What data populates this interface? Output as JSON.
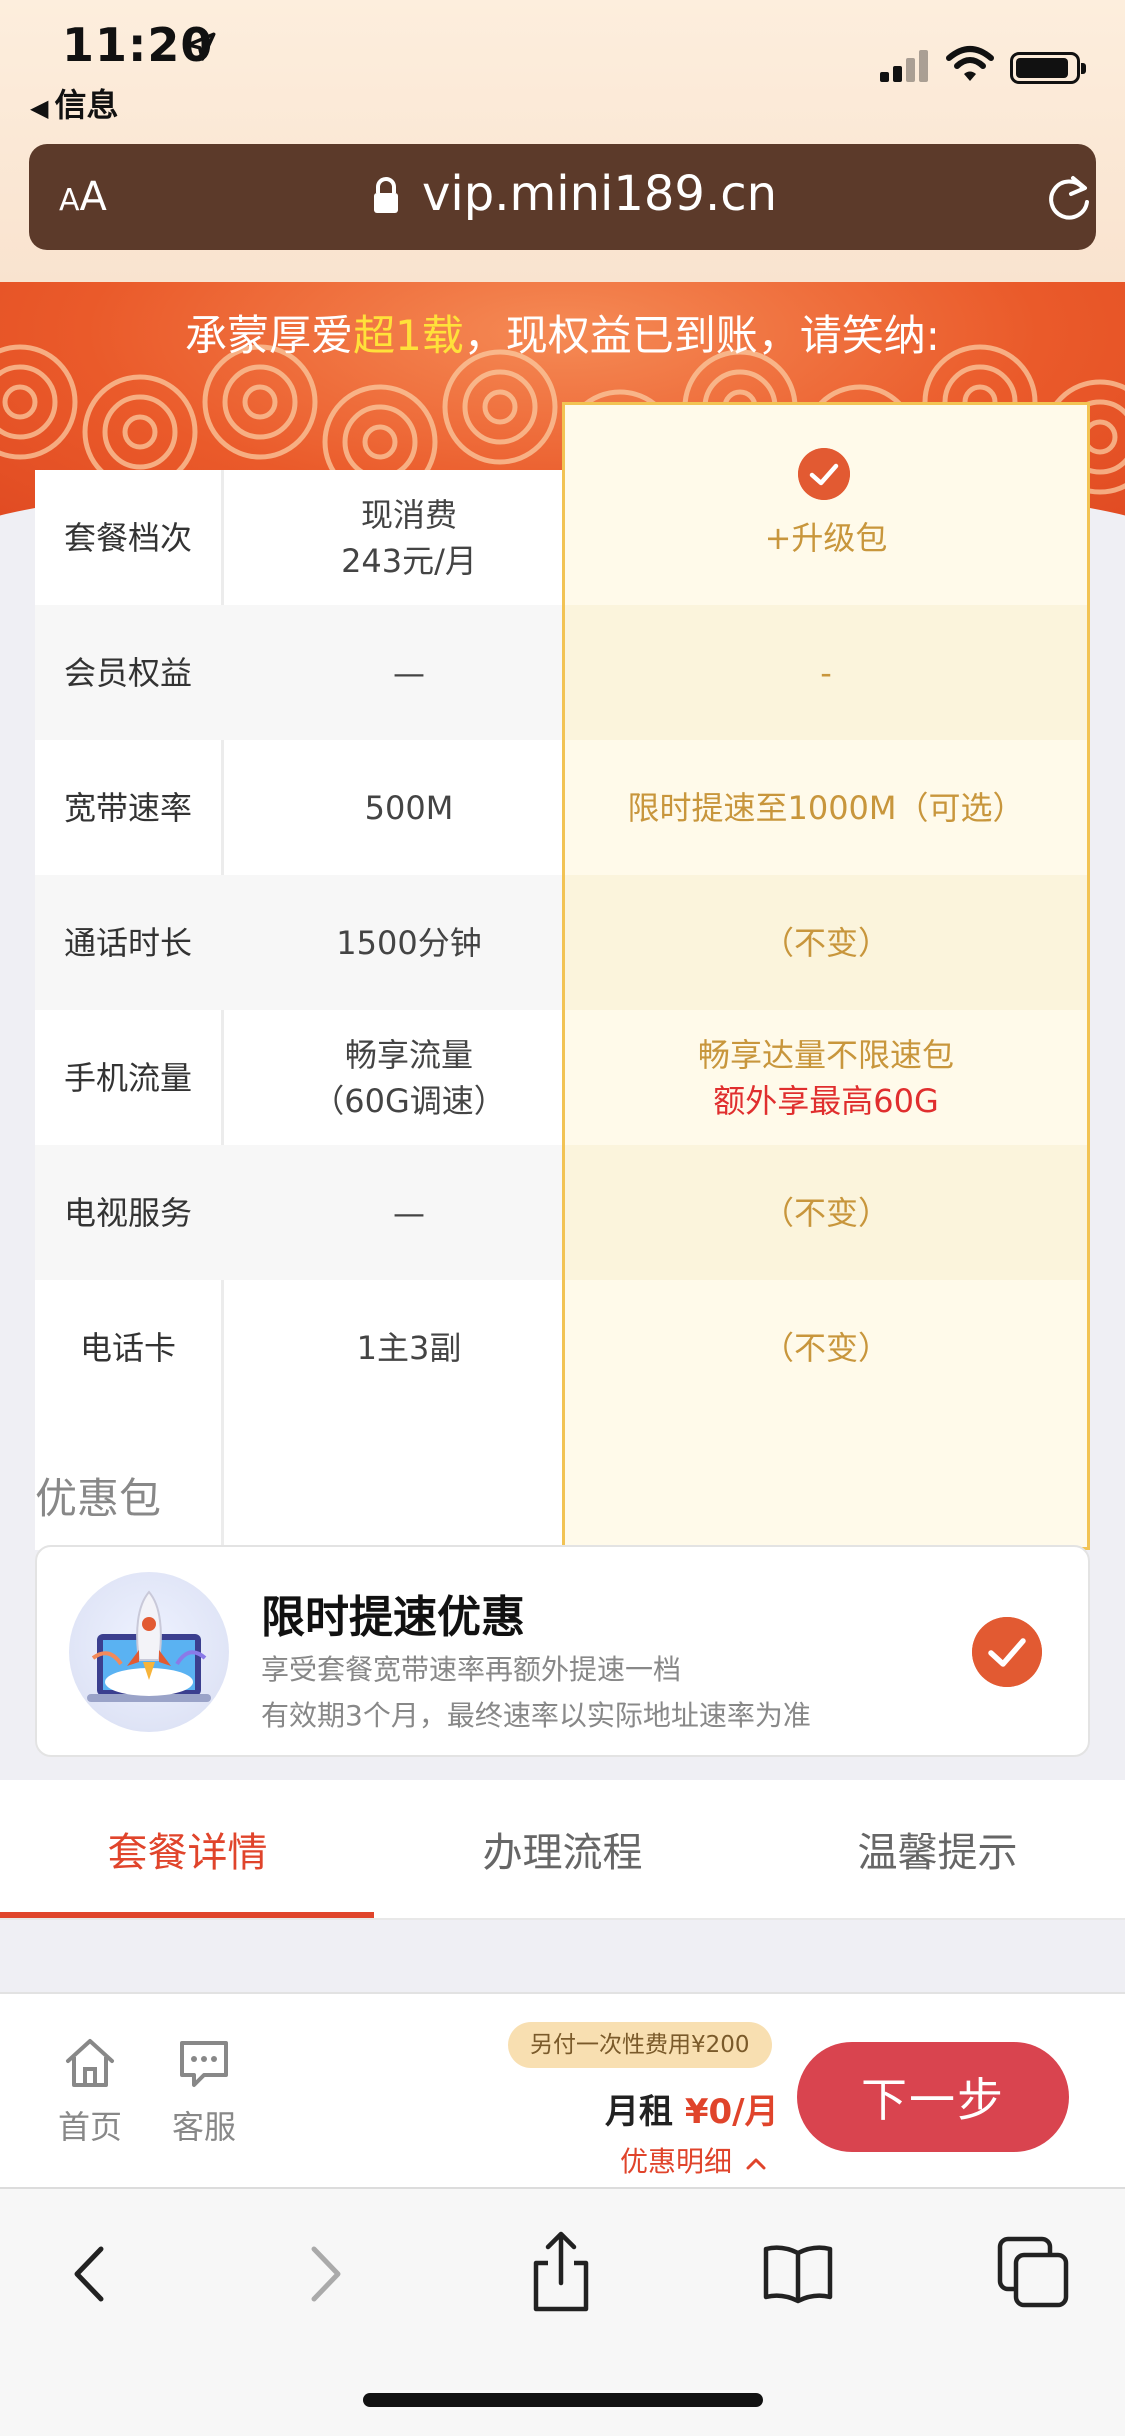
{
  "status_bar": {
    "time": "11:20",
    "back_app": "信息"
  },
  "browser": {
    "aa_label": "AA",
    "url": "vip.mini189.cn"
  },
  "banner": {
    "title_before": "承蒙厚爱",
    "title_highlight": "超1载",
    "title_after": "，现权益已到账，请笑纳:"
  },
  "table": {
    "rows": [
      {
        "label": "套餐档次",
        "current": [
          "现消费",
          "243元/月"
        ],
        "upgrade": [
          "+升级包"
        ]
      },
      {
        "label": "会员权益",
        "current": [
          "—"
        ],
        "upgrade": [
          "-"
        ]
      },
      {
        "label": "宽带速率",
        "current": [
          "500M"
        ],
        "upgrade": [
          "限时提速至1000M（可选）"
        ]
      },
      {
        "label": "通话时长",
        "current": [
          "1500分钟"
        ],
        "upgrade": [
          "（不变）"
        ]
      },
      {
        "label": "手机流量",
        "current": [
          "畅享流量",
          "（60G调速）"
        ],
        "upgrade": [
          "畅享达量不限速包",
          "额外享最高60G"
        ]
      },
      {
        "label": "电视服务",
        "current": [
          "—"
        ],
        "upgrade": [
          "（不变）"
        ]
      },
      {
        "label": "电话卡",
        "current": [
          "1主3副"
        ],
        "upgrade": [
          "（不变）"
        ]
      }
    ]
  },
  "promo": {
    "section_title": "优惠包",
    "title": "限时提速优惠",
    "desc_line1": "享受套餐宽带速率再额外提速一档",
    "desc_line2": "有效期3个月，最终速率以实际地址速率为准"
  },
  "tabs": [
    {
      "label": "套餐详情",
      "active": true
    },
    {
      "label": "办理流程",
      "active": false
    },
    {
      "label": "温馨提示",
      "active": false
    }
  ],
  "action_bar": {
    "home_label": "首页",
    "service_label": "客服",
    "fee_note": "另付一次性费用¥200",
    "rent_label": "月租",
    "rent_price": "¥0/月",
    "detail_label": "优惠明细",
    "next_label": "下一步"
  },
  "colors": {
    "accent": "#e0442b",
    "next_button": "#d9444f",
    "gold_text": "#c8963c",
    "gold_border": "#f2c353",
    "urlbar": "#5c3a2a"
  }
}
